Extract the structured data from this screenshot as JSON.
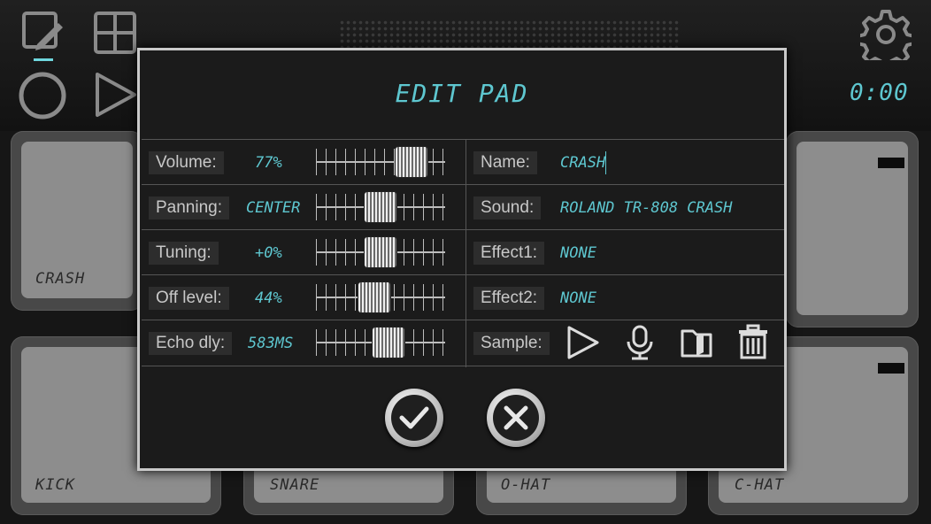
{
  "topbar": {
    "timer": "0:00"
  },
  "pads": [
    {
      "label": "CRASH"
    },
    {
      "label": ""
    },
    {
      "label": "KICK"
    },
    {
      "label": "SNARE"
    },
    {
      "label": "O-HAT"
    },
    {
      "label": "C-HAT"
    }
  ],
  "dialog": {
    "title": "EDIT PAD",
    "params": [
      {
        "label": "Volume:",
        "value": "77%",
        "slider_percent": 82
      },
      {
        "label": "Panning:",
        "value": "CENTER",
        "slider_percent": 50
      },
      {
        "label": "Tuning:",
        "value": "+0%",
        "slider_percent": 50
      },
      {
        "label": "Off level:",
        "value": "44%",
        "slider_percent": 44
      },
      {
        "label": "Echo dly:",
        "value": "583MS",
        "slider_percent": 58
      }
    ],
    "props": [
      {
        "label": "Name:",
        "value": "CRASH"
      },
      {
        "label": "Sound:",
        "value": "ROLAND TR-808 CRASH"
      },
      {
        "label": "Effect1:",
        "value": "NONE"
      },
      {
        "label": "Effect2:",
        "value": "NONE"
      }
    ],
    "sample_label": "Sample:"
  },
  "icons": {
    "edit": "edit-pad-icon",
    "grid": "grid-icon",
    "record": "record-icon",
    "play": "play-icon",
    "settings": "gear-icon",
    "sample_play": "play-icon",
    "sample_mic": "microphone-icon",
    "sample_folder": "open-folder-icon",
    "sample_delete": "trash-icon",
    "ok": "checkmark-icon",
    "cancel": "close-icon"
  },
  "colors": {
    "accent": "#5ec7d0",
    "label": "#c8c8c8",
    "frame": "#c9c9c9"
  }
}
